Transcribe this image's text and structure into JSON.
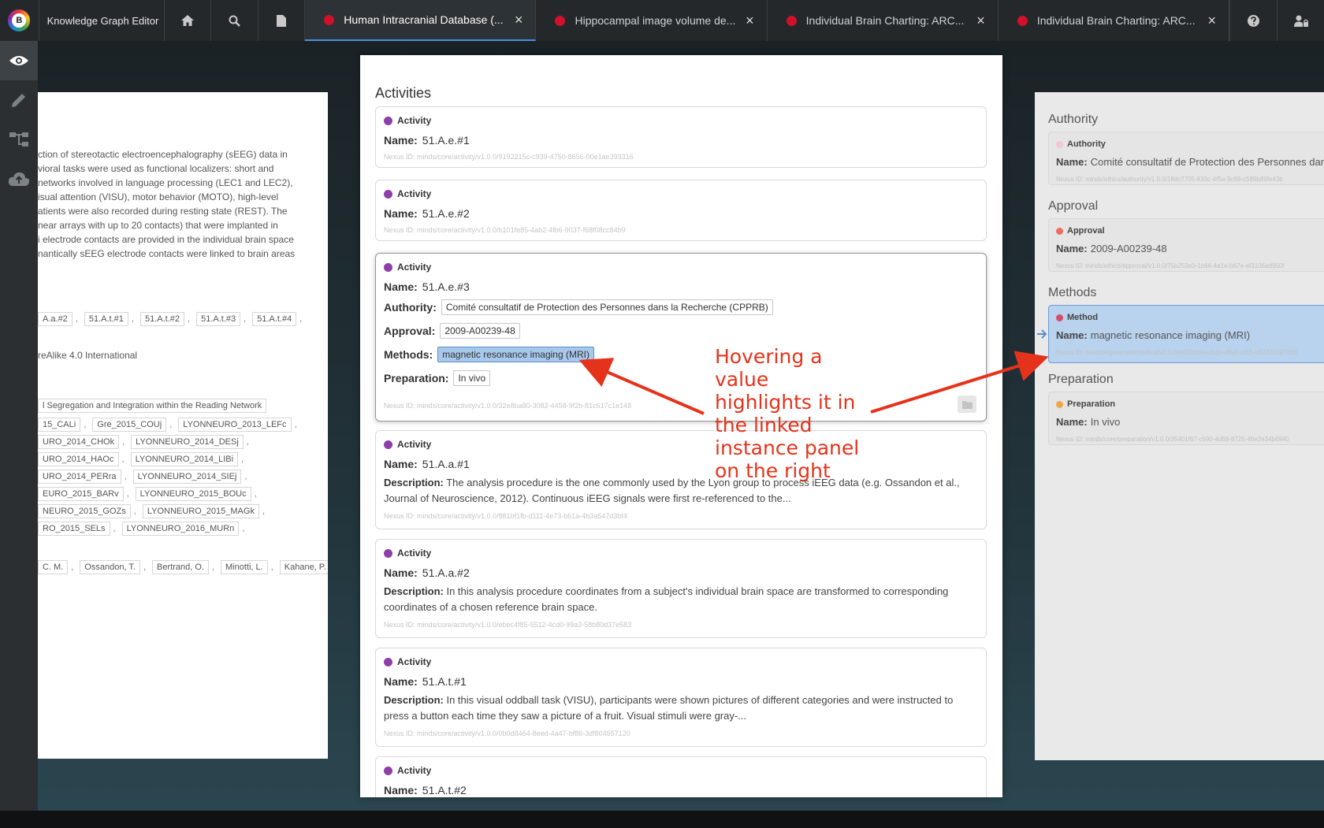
{
  "app": {
    "logo_letter": "B",
    "title": "Knowledge Graph Editor"
  },
  "tabs": [
    {
      "label": "Human Intracranial Database (...",
      "active": true
    },
    {
      "label": "Hippocampal image volume de...",
      "active": false
    },
    {
      "label": "Individual Brain Charting: ARC...",
      "active": false
    },
    {
      "label": "Individual Brain Charting: ARC...",
      "active": false
    }
  ],
  "tab_close": "×",
  "colors": {
    "accent": "#4a90d9",
    "activity": "#8e3ea8",
    "authority": "#f4c6d8",
    "approval": "#ef6b5e",
    "method": "#d94a6a",
    "preparation": "#f0a44a",
    "annotation": "#e5331b"
  },
  "left": {
    "text": [
      "ction of stereotactic electroencephalography (sEEG) data in",
      "vioral tasks were used as functional localizers: short and",
      "networks involved in language processing (LEC1 and LEC2),",
      "isual attention (VISU), motor behavior (MOTO), high-level",
      "atients were also recorded during resting state (REST). The",
      "near arrays with up to 20 contacts) that were implanted in",
      "i electrode contacts are provided in the individual brain space",
      "nantically sEEG electrode contacts were linked to brain areas"
    ],
    "chips_row1": [
      "A.a.#2",
      "51.A.t.#1",
      "51.A.t.#2",
      "51.A.t.#3",
      "51.A.t.#4"
    ],
    "license": "reAlike 4.0 International",
    "project": "l Segregation and Integration within the Reading Network",
    "subjects": [
      [
        "15_CALi",
        "Gre_2015_COUj",
        "LYONNEURO_2013_LEFc"
      ],
      [
        "URO_2014_CHOk",
        "LYONNEURO_2014_DESj"
      ],
      [
        "URO_2014_HAOc",
        "LYONNEURO_2014_LIBi"
      ],
      [
        "URO_2014_PERra",
        "LYONNEURO_2014_SIEj"
      ],
      [
        "EURO_2015_BARv",
        "LYONNEURO_2015_BOUc"
      ],
      [
        "NEURO_2015_GOZs",
        "LYONNEURO_2015_MAGk"
      ],
      [
        "RO_2015_SELs",
        "LYONNEURO_2016_MURn"
      ]
    ],
    "contributors": [
      "C. M.",
      "Ossandon, T.",
      "Bertrand, O.",
      "Minotti, L.",
      "Kahane, P."
    ],
    "sep": ","
  },
  "center": {
    "title": "Activities",
    "labels": {
      "type": "Activity",
      "name": "Name:",
      "authority": "Authority:",
      "approval": "Approval:",
      "methods": "Methods:",
      "preparation": "Preparation:",
      "description": "Description:"
    },
    "activities": [
      {
        "name": "51.A.e.#1",
        "nexus": "Nexus ID: minds/core/activity/v1.0.0/9192215c-c939-4750-8656-00e1ae393316"
      },
      {
        "name": "51.A.e.#2",
        "nexus": "Nexus ID: minds/core/activity/v1.0.0/b101fe85-4ab2-4fb6-9037-f68f08cc84b9"
      },
      {
        "name": "51.A.e.#3",
        "authority": "Comité consultatif de Protection des Personnes dans la Recherche (CPPRB)",
        "approval": "2009-A00239-48",
        "methods": "magnetic resonance imaging (MRI)",
        "preparation": "In vivo",
        "nexus": "Nexus ID: minds/core/activity/v1.0.0/32e8ba80-3082-4458-9f2b-81c617c1e148"
      },
      {
        "name": "51.A.a.#1",
        "description": "The analysis procedure is the one commonly used by the Lyon group to process iEEG data (e.g. Ossandon et al., Journal of Neuroscience, 2012). Continuous iEEG signals were first re-referenced to the...",
        "nexus": "Nexus ID: minds/core/activity/v1.0.0/881bf1fb-d111-4e73-b61a-4b3a547d3bf4"
      },
      {
        "name": "51.A.a.#2",
        "description": "In this analysis procedure coordinates from a subject's individual brain space are transformed to corresponding coordinates of a chosen reference brain space.",
        "nexus": "Nexus ID: minds/core/activity/v1.0.0/ebec4f85-5512-4cd0-99a3-58b80d37e583"
      },
      {
        "name": "51.A.t.#1",
        "description": "In this visual oddball task (VISU), participants were shown pictures of different categories and were instructed to press a button each time they saw a picture of a fruit. Visual stimuli were gray-...",
        "nexus": "Nexus ID: minds/core/activity/v1.0.0/0b0d8464-8eed-4a47-bf86-3df804557120"
      },
      {
        "name": "51.A.t.#2"
      }
    ]
  },
  "right": {
    "sections": [
      {
        "heading": "Authority",
        "type": "Authority",
        "name": "Comité consultatif de Protection des Personnes dans la Recherche (CPPRB)",
        "nexus": "Nexus ID: minds/ethics/authority/v1.0.0/18dc7705-833c-4f5a-9c68-c589b89fe43b"
      },
      {
        "heading": "Approval",
        "type": "Approval",
        "name": "2009-A00239-48",
        "nexus": "Nexus ID: minds/ethics/approval/v1.0.0/75b253a0-1b66-4a1e-b67e-ef3106ad950f"
      },
      {
        "heading": "Methods",
        "type": "Method",
        "name": "magnetic resonance imaging (MRI)",
        "nexus": "Nexus ID: minds/experiment/method/v1.0.0/e430cbea-4a1e-46a5-af15-a52376187848"
      },
      {
        "heading": "Preparation",
        "type": "Preparation",
        "name": "In vivo",
        "nexus": "Nexus ID: minds/core/preparation/v1.0.0/35401f67-c590-4d68-8725-46e2e34b6940"
      }
    ],
    "name_label": "Name:"
  },
  "annotation": {
    "text": "Hovering a value highlights it in the linked instance panel on the right"
  }
}
